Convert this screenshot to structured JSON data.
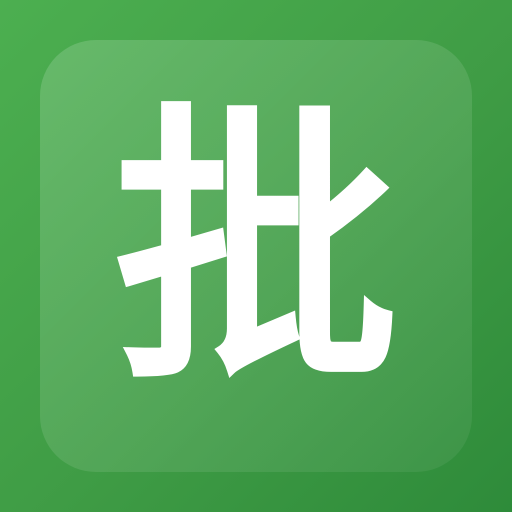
{
  "app_icon": {
    "character": "批",
    "colors": {
      "background_start": "#4caf50",
      "background_end": "#2e8b3a",
      "glyph": "#ffffff"
    }
  }
}
